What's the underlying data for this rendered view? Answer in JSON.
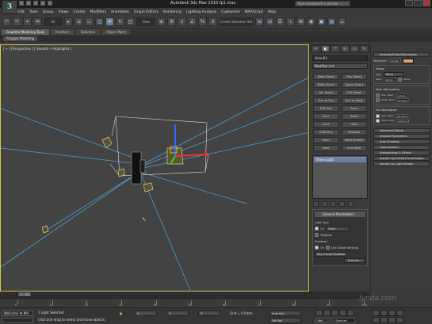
{
  "app": {
    "title": "Autodesk 3ds Max 2010    fp1.max",
    "logo_letter": "3",
    "search_placeholder": "Type a keyword or phrase"
  },
  "menu": [
    "Edit",
    "Tools",
    "Group",
    "Views",
    "Create",
    "Modifiers",
    "Animation",
    "Graph Editors",
    "Rendering",
    "Lighting Analysis",
    "Customize",
    "MAXScript",
    "Help"
  ],
  "toolbar": {
    "selection_filter": "All",
    "view_dropdown": "View",
    "selection_set": "Create Selection Set"
  },
  "ribbon": {
    "tabs": [
      "Graphite Modeling Tools",
      "Freeform",
      "Selection",
      "Object Paint"
    ],
    "subtab": "Polygon Modeling"
  },
  "viewport": {
    "label": "[ + ] [Perspective ] [ Smooth + Highlights ]"
  },
  "command_panel": {
    "tabs": [
      "create",
      "modify",
      "hierarchy",
      "motion",
      "display",
      "utilities"
    ],
    "object_name": "Omni01",
    "modifier_list": "Modifier List",
    "buttons": [
      "Mesh Select",
      "Poly Select",
      "Patch Select",
      "Spline Select",
      "Vol. Select",
      "FFD Select",
      "Turn to Poly",
      "Turn to Mesh",
      "Edit Poly",
      "Bend",
      "Slice",
      "Noise",
      "Shell",
      "Lathe",
      "UVW Map",
      "Displace",
      "Taper",
      "Mesh Smooth",
      "Twist",
      "Edit Mesh"
    ],
    "stack_item": "Omni Light",
    "general_params": {
      "header": "General Parameters",
      "light_type_label": "Light Type",
      "on_label": "On",
      "type_value": "Omni",
      "targeted_label": "Targeted",
      "shadows_label": "Shadows",
      "shadows_on_label": "On",
      "global_settings_label": "Use Global Settings",
      "shadow_type": "Ray Traced Shadows",
      "exclude_label": "Exclude..."
    }
  },
  "param_panel": {
    "header": "Intensity/Color/Attenuation",
    "multiplier_label": "Multiplier:",
    "multiplier_value": "0.0336",
    "decay_label": "Decay",
    "decay_type_label": "Type:",
    "decay_type": "None",
    "decay_start_label": "Start:",
    "decay_start_value": "40.0m",
    "show_label": "Show",
    "near_header": "Near Attenuation",
    "far_header": "Far Attenuation",
    "use_label": "Use",
    "show2_label": "Show",
    "start_label": "Start:",
    "end_label": "End:",
    "near_start": "0.0mm",
    "near_end": "40.0mm",
    "far_start": "80.0mm",
    "far_end": "200.0mm",
    "rollouts": [
      "Advanced Effects",
      "Shadow Parameters",
      "Area Shadows",
      "Optimizations",
      "Atmospheres & Effects",
      "mental ray Indirect Illumination",
      "mental ray Light Shader"
    ],
    "color_swatch": "#e8a07a"
  },
  "timeline": {
    "thumb": "0 / 100",
    "ticks": [
      "0",
      "10",
      "20",
      "30",
      "40",
      "50",
      "60",
      "70",
      "80",
      "90",
      "100"
    ]
  },
  "status": {
    "maxscript": "Welcome to MA",
    "line1": "1 Light Selected",
    "line2": "Click and drag to select and move objects",
    "x_label": "X:",
    "y_label": "Y:",
    "z_label": "Z:",
    "grid_label": "Grid = 0.0mm",
    "autokey_label": "Auto Key",
    "setkey_label": "Set Key",
    "selected_label": "Selected",
    "keyfilters_label": "Key Filters..."
  },
  "watermark": "lynda.com",
  "colors": {
    "viewport_bg": "#444343",
    "viewport_border": "#d9c64a",
    "light_line": "#4aa2d6",
    "gizmo_red": "#e33",
    "gizmo_green": "#3c3",
    "gizmo_blue": "#36f",
    "light_icon": "#d8d080"
  }
}
